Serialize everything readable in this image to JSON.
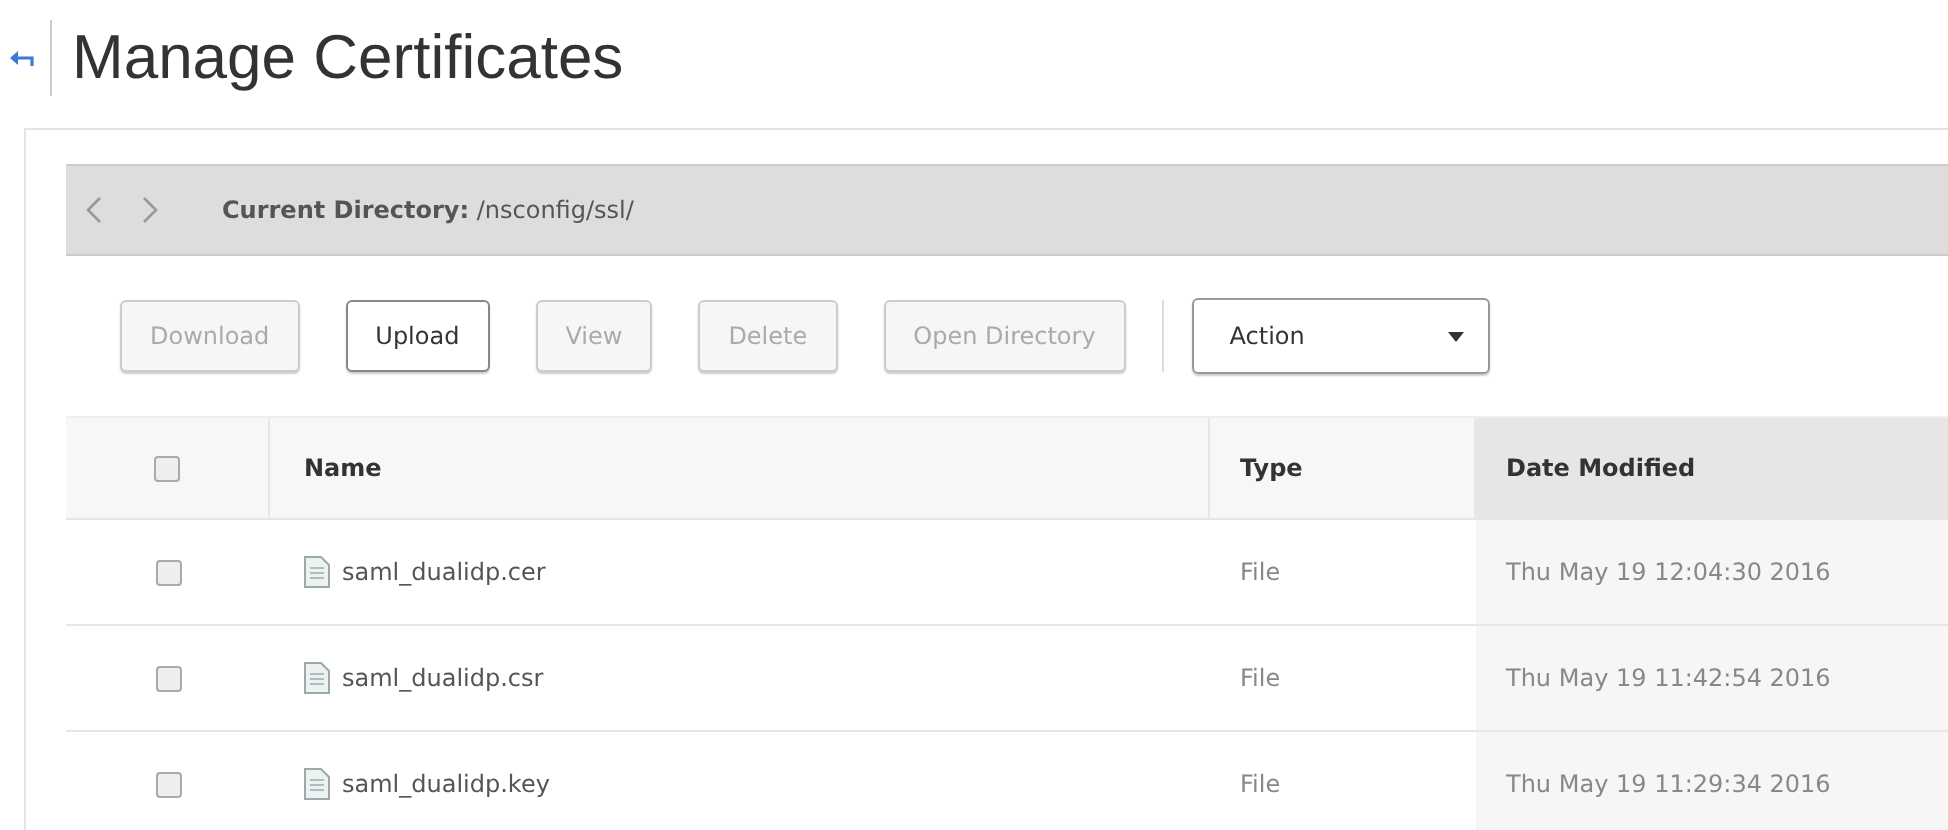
{
  "page": {
    "title": "Manage Certificates"
  },
  "directory": {
    "label": "Current Directory:",
    "path": "/nsconfig/ssl/"
  },
  "toolbar": {
    "buttons": [
      {
        "label": "Download",
        "disabled": true
      },
      {
        "label": "Upload",
        "disabled": false
      },
      {
        "label": "View",
        "disabled": true
      },
      {
        "label": "Delete",
        "disabled": true
      },
      {
        "label": "Open Directory",
        "disabled": true
      }
    ],
    "action": {
      "value": "Action"
    }
  },
  "table": {
    "select_all": {
      "checked": false
    },
    "columns": [
      {
        "label": "Name",
        "sorted": false
      },
      {
        "label": "Type",
        "sorted": false
      },
      {
        "label": "Date Modified",
        "sorted": true
      }
    ],
    "rows": [
      {
        "checked": false,
        "name": "saml_dualidp.cer",
        "type": "File",
        "date": "Thu May 19 12:04:30 2016"
      },
      {
        "checked": false,
        "name": "saml_dualidp.csr",
        "type": "File",
        "date": "Thu May 19 11:42:54 2016"
      },
      {
        "checked": false,
        "name": "saml_dualidp.key",
        "type": "File",
        "date": "Thu May 19 11:29:34 2016"
      }
    ]
  }
}
